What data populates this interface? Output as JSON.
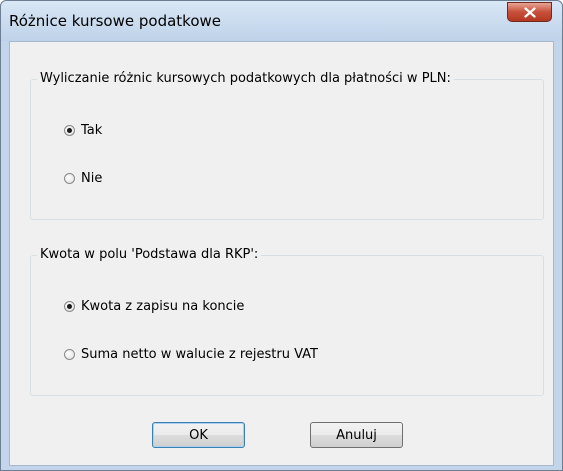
{
  "window": {
    "title": "Różnice kursowe podatkowe"
  },
  "group1": {
    "legend": "Wyliczanie różnic kursowych podatkowych dla płatności w PLN:",
    "options": [
      {
        "label": "Tak",
        "checked": true
      },
      {
        "label": "Nie",
        "checked": false
      }
    ]
  },
  "group2": {
    "legend": "Kwota w polu 'Podstawa dla RKP':",
    "options": [
      {
        "label": "Kwota z zapisu na koncie",
        "checked": true
      },
      {
        "label": "Suma netto w walucie z rejestru VAT",
        "checked": false
      }
    ]
  },
  "buttons": {
    "ok": "OK",
    "cancel": "Anuluj"
  },
  "colors": {
    "frame": "#c3d5ea",
    "client": "#f0f0f0",
    "close_button": "#c7503a"
  },
  "icons": {
    "close": "close-icon"
  }
}
